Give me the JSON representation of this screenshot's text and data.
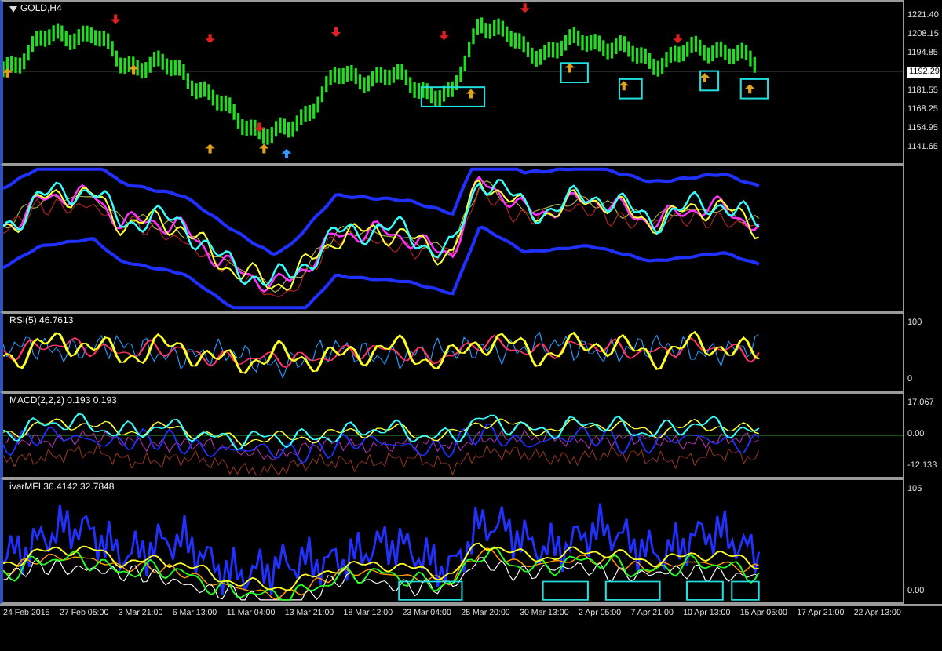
{
  "chart": {
    "symbol": "GOLD,H4",
    "price_axis": [
      "1221.40",
      "1208.15",
      "1194.85",
      "1181.55",
      "1168.25",
      "1154.95",
      "1141.65"
    ],
    "current_price": "1192.29"
  },
  "panels": [
    {
      "kind": "bands"
    },
    {
      "kind": "rsi",
      "title": "RSI(5) 46.7613",
      "scale": [
        "100",
        "0"
      ]
    },
    {
      "kind": "macd",
      "title": "MACD(2,2,2) 0.193 0.193",
      "scale": [
        "17.067",
        "0.00",
        "-12.133"
      ]
    },
    {
      "kind": "mfi",
      "title": "ivarMFI 36.4142 32.7848",
      "scale": [
        "105",
        "0.00"
      ]
    }
  ],
  "time_axis": [
    "24 Feb 2015",
    "27 Feb 05:00",
    "3 Mar 21:00",
    "6 Mar 13:00",
    "11 Mar 04:00",
    "13 Mar 21:00",
    "18 Mar 12:00",
    "23 Mar 04:00",
    "25 Mar 20:00",
    "30 Mar 13:00",
    "2 Apr 05:00",
    "7 Apr 21:00",
    "10 Apr 13:00",
    "15 Apr 05:00",
    "17 Apr 21:00",
    "22 Apr 13:00"
  ]
}
